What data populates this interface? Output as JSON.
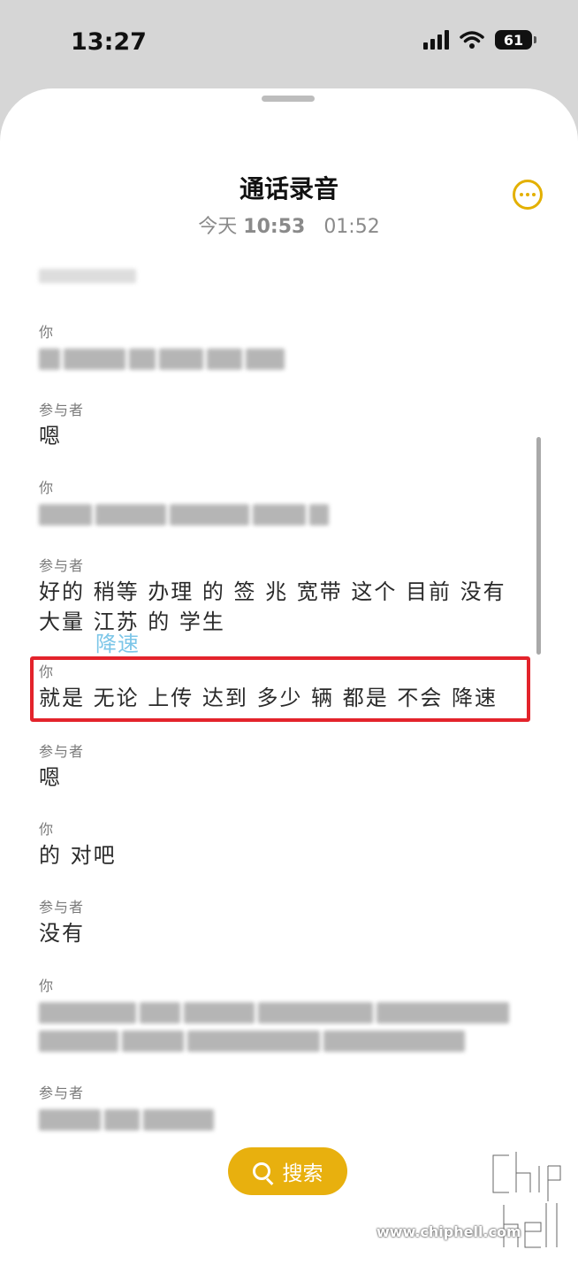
{
  "status_bar": {
    "time": "13:27",
    "battery": "61"
  },
  "header": {
    "title": "通话录音",
    "date_prefix": "今天",
    "time": "10:53",
    "duration": "01:52"
  },
  "transcript": [
    {
      "speaker": "你",
      "text": ""
    },
    {
      "speaker": "参与者",
      "text": "嗯"
    },
    {
      "speaker": "你",
      "text": ""
    },
    {
      "speaker": "参与者",
      "text_line1": "好的 稍等 办理 的 签 兆 宽带 这个 目前 没有",
      "text_line2": "大量 江苏 的 学生"
    },
    {
      "speaker": "你",
      "text": "就是 无论 上传 达到 多少 辆 都是 不会 降速"
    },
    {
      "speaker": "参与者",
      "text": "嗯"
    },
    {
      "speaker": "你",
      "text": "的 对吧"
    },
    {
      "speaker": "参与者",
      "text": "没有"
    },
    {
      "speaker": "你",
      "text": ""
    },
    {
      "speaker": "参与者",
      "text": ""
    }
  ],
  "hint_text": "降速",
  "search_label": "搜索",
  "watermark": {
    "url": "www.chiphell.com",
    "logo": "chip hell"
  },
  "colors": {
    "accent": "#e8b00e",
    "highlight": "#e3232b",
    "hint": "#7cc6e8"
  },
  "icons": [
    "signal-icon",
    "wifi-icon",
    "battery-icon",
    "more-icon",
    "search-icon"
  ]
}
